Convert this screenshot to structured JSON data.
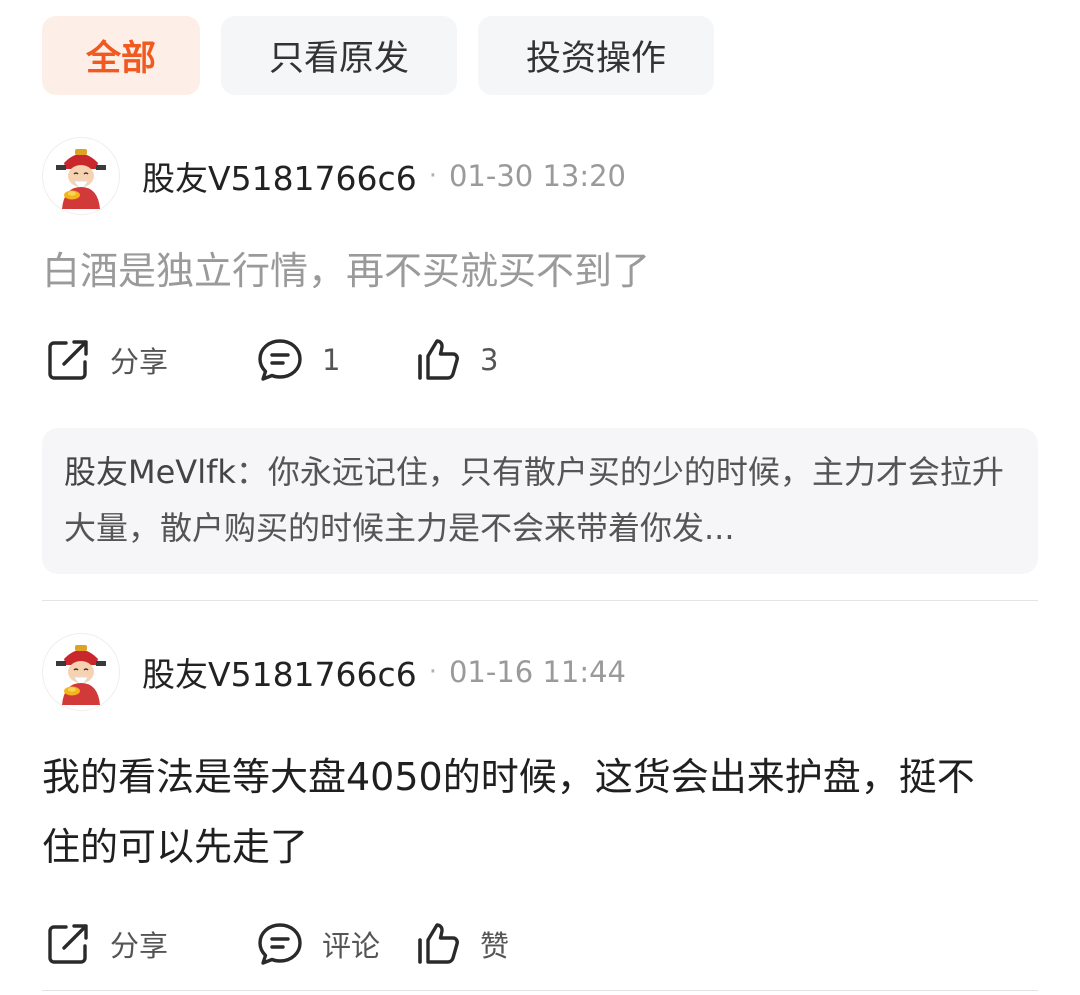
{
  "tabs": [
    {
      "label": "全部",
      "active": true
    },
    {
      "label": "只看原发",
      "active": false
    },
    {
      "label": "投资操作",
      "active": false
    }
  ],
  "posts": [
    {
      "username": "股友V5181766c6",
      "separator": "·",
      "timestamp": "01-30 13:20",
      "content": "白酒是独立行情，再不买就买不到了",
      "actions": {
        "share": "分享",
        "comment": "1",
        "like": "3"
      },
      "reply": {
        "author": "股友MeVlfk",
        "text": "：你永远记住，只有散户买的少的时候，主力才会拉升大量，散户购买的时候主力是不会来带着你发..."
      }
    },
    {
      "username": "股友V5181766c6",
      "separator": "·",
      "timestamp": "01-16 11:44",
      "content": "我的看法是等大盘4050的时候，这货会出来护盘，挺不住的可以先走了",
      "actions": {
        "share": "分享",
        "comment": "评论",
        "like": "赞"
      }
    }
  ],
  "colors": {
    "accent": "#f05a20",
    "active_tab_bg": "#fdeee7",
    "tab_bg": "#f5f6f8",
    "muted_text": "#9a9a9a",
    "reply_bg": "#f6f6f8"
  },
  "icons": {
    "avatar": "caishen-avatar-icon",
    "share": "share-icon",
    "comment": "comment-icon",
    "like": "thumbs-up-icon"
  }
}
